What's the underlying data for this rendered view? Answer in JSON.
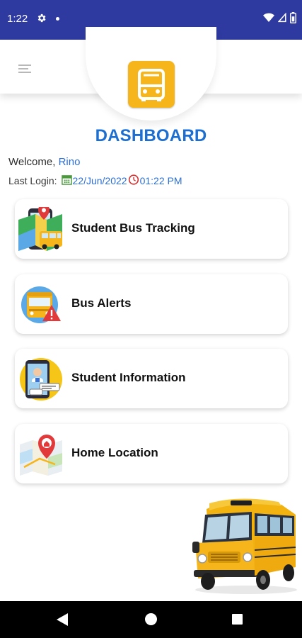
{
  "status_bar": {
    "time": "1:22",
    "icons": [
      "settings-gear-icon",
      "notification-dot-icon",
      "wifi-icon",
      "cell-signal-icon",
      "battery-icon"
    ]
  },
  "header": {
    "menu_icon": "hamburger-menu-icon",
    "logo_icon": "school-bus-icon",
    "title": "DASHBOARD"
  },
  "user": {
    "welcome_label": "Welcome,",
    "name": "Rino",
    "last_login_label": "Last Login:",
    "last_login_date": "22/Jun/2022",
    "last_login_time": "01:22 PM"
  },
  "menu": [
    {
      "label": "Student Bus Tracking",
      "icon": "bus-map-tracking-icon"
    },
    {
      "label": "Bus Alerts",
      "icon": "bus-alert-icon"
    },
    {
      "label": "Student Information",
      "icon": "student-id-phone-icon"
    },
    {
      "label": "Home Location",
      "icon": "home-location-map-icon"
    }
  ],
  "colors": {
    "status_bar": "#2f3aa0",
    "title_blue": "#1c6fd0",
    "accent_yellow": "#f5b51b",
    "link_blue": "#2d6fd4"
  },
  "nav": {
    "icons": [
      "back-icon",
      "home-icon",
      "recents-icon"
    ]
  }
}
